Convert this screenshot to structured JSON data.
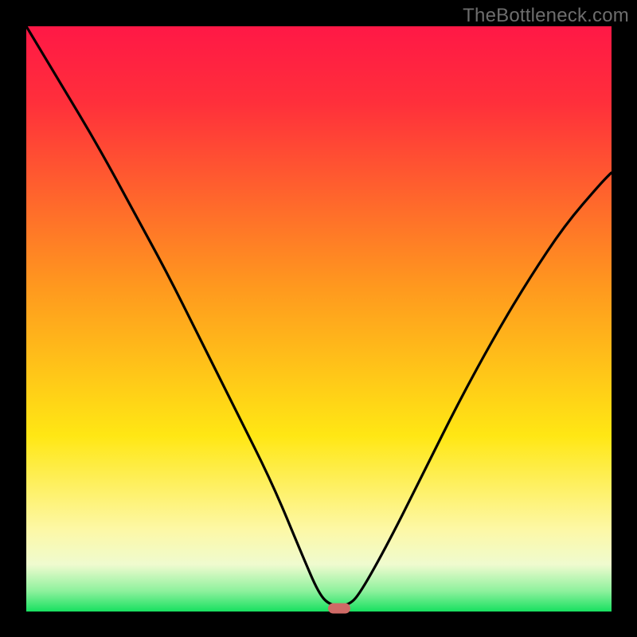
{
  "watermark": "TheBottleneck.com",
  "colors": {
    "top": "#ff1846",
    "red_upper": "#ff2f3b",
    "orange": "#ff9a1e",
    "yellow": "#ffe714",
    "pale": "#fdf8a6",
    "cream": "#effbcf",
    "lightgreen": "#8ef19d",
    "green": "#18e060",
    "curve": "#000000",
    "marker": "#cf6a66"
  },
  "chart_data": {
    "type": "line",
    "title": "",
    "xlabel": "",
    "ylabel": "",
    "xlim": [
      0,
      100
    ],
    "ylim": [
      0,
      100
    ],
    "grid": false,
    "legend": false,
    "annotations": [
      "TheBottleneck.com"
    ],
    "series": [
      {
        "name": "bottleneck-curve",
        "x": [
          0,
          6,
          12,
          18,
          24,
          30,
          36,
          42,
          47,
          50,
          52,
          55,
          57,
          62,
          68,
          74,
          80,
          86,
          92,
          98,
          100
        ],
        "values": [
          100,
          90,
          80,
          69,
          58,
          46,
          34,
          22,
          10,
          3,
          1,
          1,
          3,
          12,
          24,
          36,
          47,
          57,
          66,
          73,
          75
        ]
      }
    ],
    "marker": {
      "x": 53.5,
      "y": 0.5
    }
  }
}
